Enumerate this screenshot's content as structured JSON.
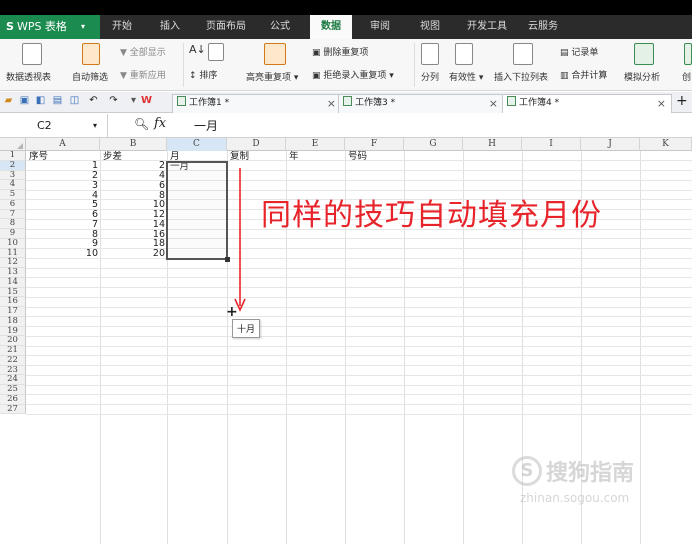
{
  "app": {
    "menu_label": "WPS 表格",
    "logo_glyph": "S"
  },
  "ribbon_tabs": [
    {
      "label": "开始"
    },
    {
      "label": "插入"
    },
    {
      "label": "页面布局"
    },
    {
      "label": "公式"
    },
    {
      "label": "数据",
      "active": true
    },
    {
      "label": "审阅"
    },
    {
      "label": "视图"
    },
    {
      "label": "开发工具"
    },
    {
      "label": "云服务"
    }
  ],
  "ribbon": {
    "pivot": "数据透视表",
    "autofilter": "自动筛选",
    "show_all": "全部显示",
    "reapply": "重新应用",
    "sort": "排序",
    "highlight_dup": "高亮重复项",
    "delete_dup": "删除重复项",
    "reject_dup": "拒绝录入重复项",
    "split": "分列",
    "validity": "有效性",
    "dropdown": "插入下拉列表",
    "record": "记录单",
    "consolidate": "合并计算",
    "simulate": "模拟分析",
    "create": "创"
  },
  "doc_tabs": [
    {
      "label": "工作簿1 *",
      "active": false
    },
    {
      "label": "工作簿3 *",
      "active": false
    },
    {
      "label": "工作簿4 *",
      "active": true
    }
  ],
  "formula_bar": {
    "name_box": "C2",
    "fx_label": "fx",
    "content": "一月"
  },
  "columns": [
    "A",
    "B",
    "C",
    "D",
    "E",
    "F",
    "G",
    "H",
    "I",
    "J",
    "K"
  ],
  "rows": [
    "1",
    "2",
    "3",
    "4",
    "5",
    "6",
    "7",
    "8",
    "9",
    "10",
    "11",
    "12",
    "13",
    "14",
    "15",
    "16",
    "17",
    "18",
    "19",
    "20",
    "21",
    "22",
    "23",
    "24",
    "25",
    "26",
    "27"
  ],
  "headers": {
    "A": "序号",
    "B": "步差",
    "C": "月",
    "D": "复制",
    "E": "年",
    "F": "号码"
  },
  "col_a_values": [
    "1",
    "2",
    "3",
    "4",
    "5",
    "6",
    "7",
    "8",
    "9",
    "10"
  ],
  "col_b_values": [
    "2",
    "4",
    "6",
    "8",
    "10",
    "12",
    "14",
    "16",
    "18",
    "20"
  ],
  "c2_value": "一月",
  "fill_tooltip": "十月",
  "annotation": "同样的技巧自动填充月份",
  "watermark": {
    "brand": "搜狗指南",
    "url": "zhinan.sogou.com",
    "glyph": "S"
  },
  "colors": {
    "accent_green": "#1c8b4f",
    "annotation_red": "#e8242b"
  },
  "selection": "C2:C11"
}
